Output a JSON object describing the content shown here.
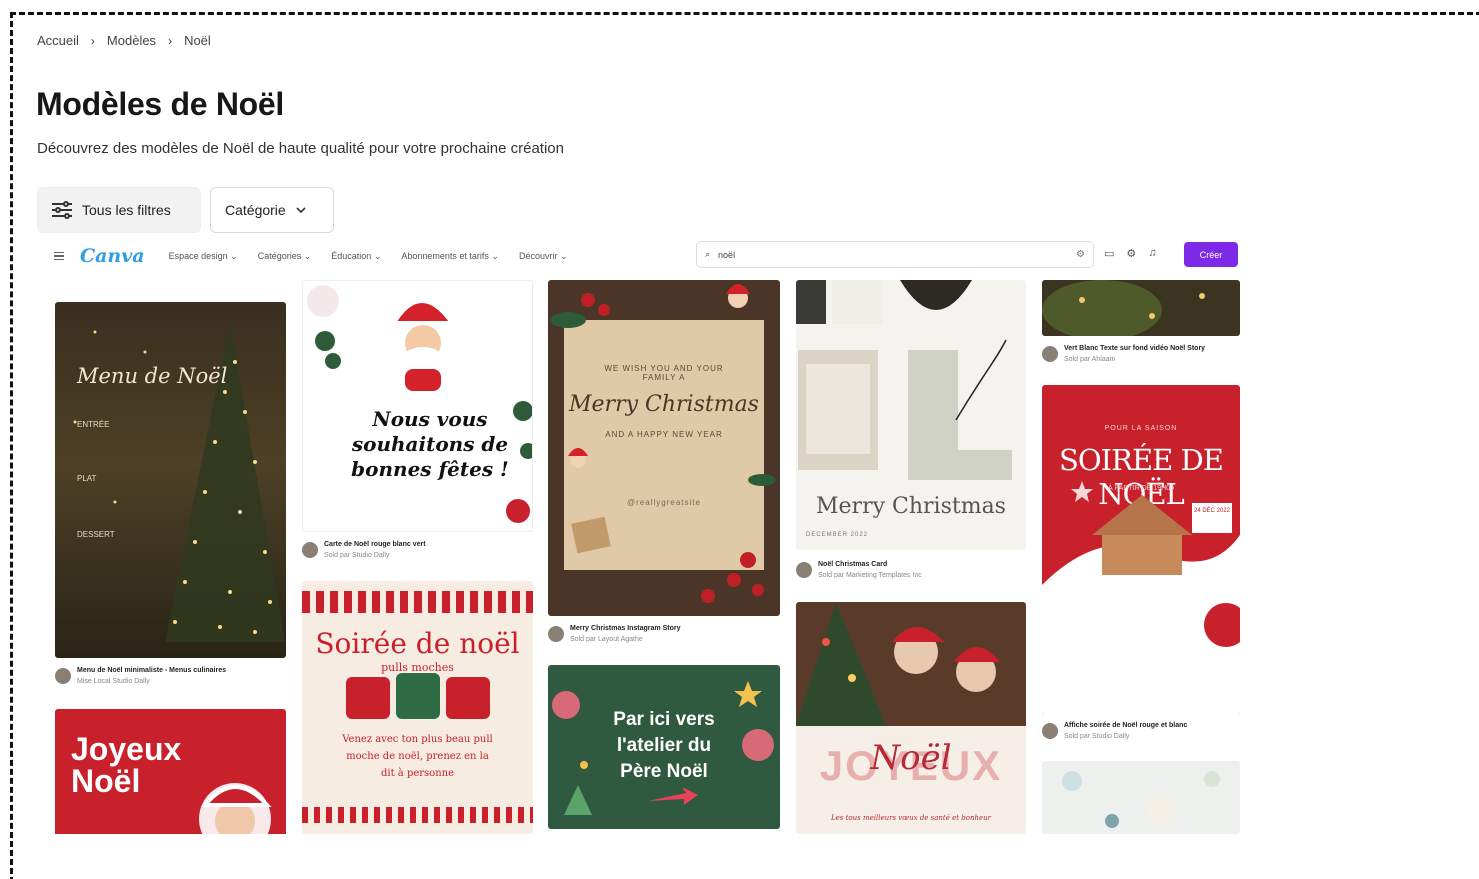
{
  "breadcrumb": {
    "items": [
      "Accueil",
      "Modèles",
      "Noël"
    ],
    "separator": "›"
  },
  "page": {
    "title": "Modèles de Noël",
    "subtitle": "Découvrez des modèles de Noël de haute qualité pour votre prochaine création"
  },
  "filters": {
    "all_label": "Tous les filtres",
    "category_label": "Catégorie",
    "all_icon": "sliders-icon",
    "category_icon": "chevron-down-icon"
  },
  "canva": {
    "logo": "Canva",
    "nav": [
      "Espace design",
      "Catégories",
      "Éducation",
      "Abonnements et tarifs",
      "Découvrir"
    ],
    "search_value": "noël",
    "create_label": "Créer",
    "accent_color": "#7d2ae8"
  },
  "cards": {
    "menu": {
      "title": "Menu de Noël",
      "courses": [
        "ENTRÉE",
        "PLAT",
        "DESSERT"
      ],
      "meta_title": "Menu de Noël minimaliste - Menus culinaires",
      "meta_sub": "Mise Local Studio Dally"
    },
    "santa_card": {
      "text": "Nous vous souhaitons de bonnes fêtes !",
      "meta_title": "Carte de Noël rouge blanc vert",
      "meta_sub": "Sold par Studio Dally"
    },
    "merry_letter": {
      "line1": "WE WISH YOU AND YOUR FAMILY A",
      "script": "Merry Christmas",
      "line2": "AND A HAPPY NEW YEAR",
      "handle": "@reallygreatsite",
      "meta_title": "Merry Christmas Instagram Story",
      "meta_sub": "Sold par Layout Agathe"
    },
    "noel_photo": {
      "script": "Merry Christmas",
      "sub": "DECEMBER 2022",
      "meta_title": "Noël Christmas Card",
      "meta_sub": "Sold par Marketing Templates Inc"
    },
    "top_right": {
      "meta_title": "Vert Blanc Texte sur fond vidéo Noël Story",
      "meta_sub": "Sold par Ahlaam"
    },
    "soiree_rouge": {
      "kicker": "POUR LA SAISON",
      "title": "SOIRÉE DE NOËL",
      "sub": "À PARTIR DE 19H00",
      "badge": "24 DÉC 2022",
      "meta_title": "Affiche soirée de Noël rouge et blanc",
      "meta_sub": "Sold par Studio Dally"
    },
    "soiree_pulls": {
      "title": "Soirée de noël",
      "sub": "pulls moches",
      "body": "Venez avec ton plus beau pull moche de noël, prenez en la dit à personne"
    },
    "atelier": {
      "text": "Par ici vers l'atelier du Père Noël"
    },
    "joyeux_red": {
      "line1": "Joyeux",
      "line2": "Noël"
    },
    "joyeux_family": {
      "big": "JOYEUX",
      "script": "Noël",
      "sub": "Les tous meilleurs vœux de santé et bonheur"
    }
  },
  "colors": {
    "christmas_red": "#c9212b",
    "dark_green": "#2f5a3f",
    "cream": "#f4ede3",
    "kraft": "#d8c3a0"
  }
}
